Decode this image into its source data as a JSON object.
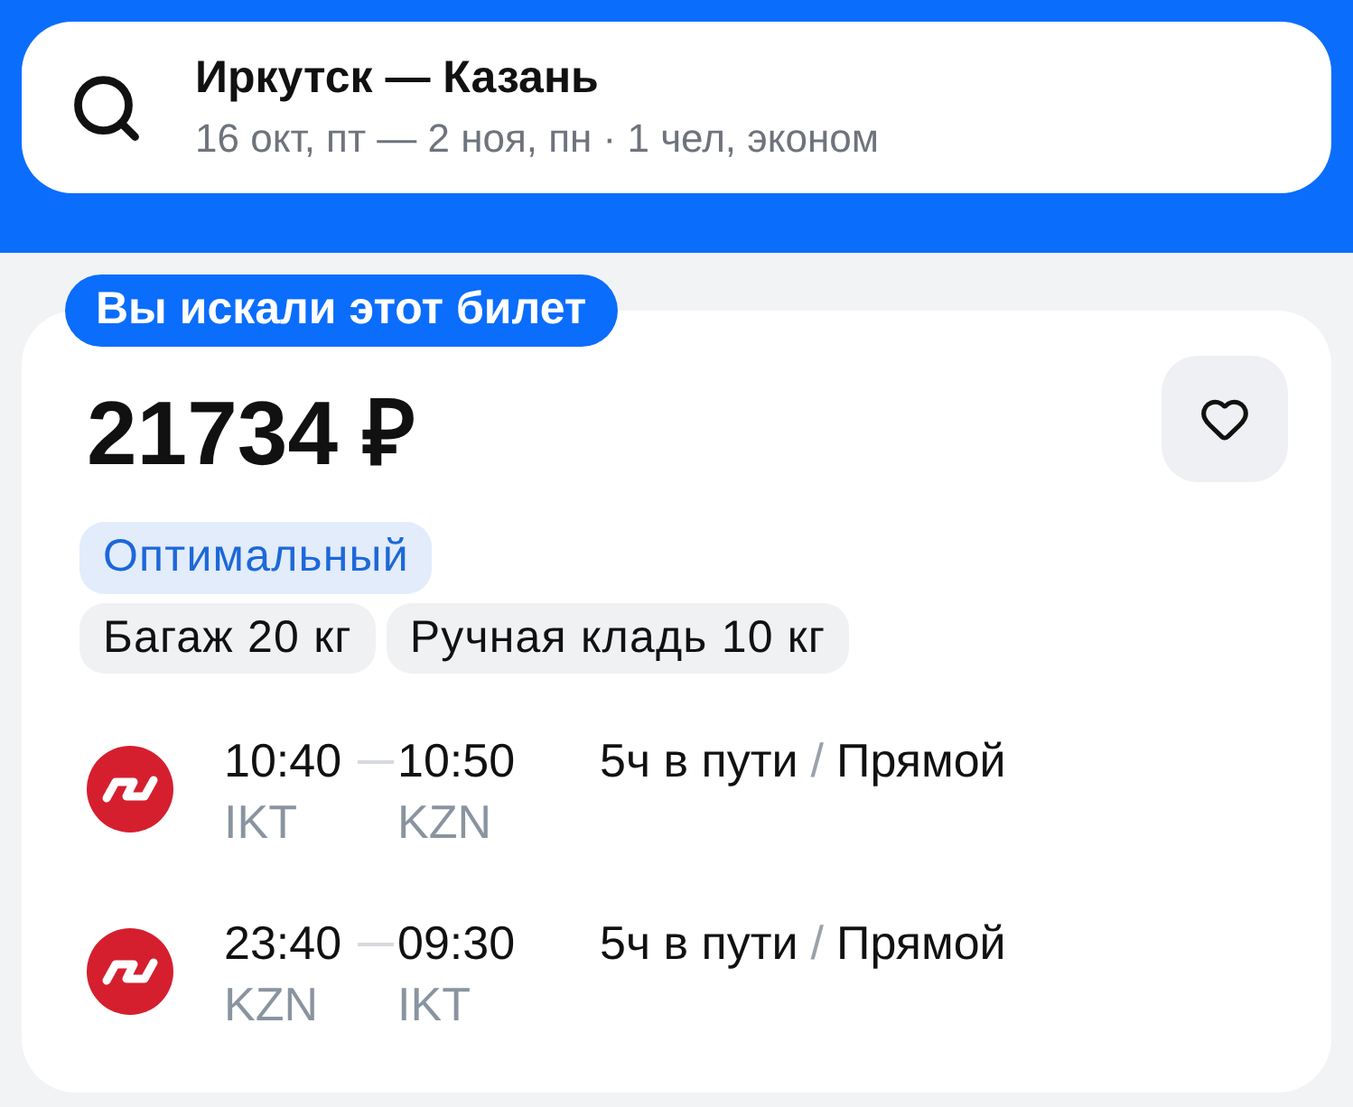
{
  "search": {
    "title": "Иркутск — Казань",
    "subtitle": "16 окт, пт — 2 ноя, пн · 1 чел, эконом"
  },
  "ticket": {
    "badge": "Вы искали этот билет",
    "price": "21734 ₽",
    "fare": "Оптимальный",
    "baggage": [
      "Багаж 20 кг",
      "Ручная кладь 10 кг"
    ],
    "flights": [
      {
        "depart_time": "10:40",
        "arrive_time": "10:50",
        "from": "IKT",
        "to": "KZN",
        "duration": "5ч в пути",
        "separator": "/",
        "stops": "Прямой"
      },
      {
        "depart_time": "23:40",
        "arrive_time": "09:30",
        "from": "KZN",
        "to": "IKT",
        "duration": "5ч в пути",
        "separator": "/",
        "stops": "Прямой"
      }
    ]
  }
}
